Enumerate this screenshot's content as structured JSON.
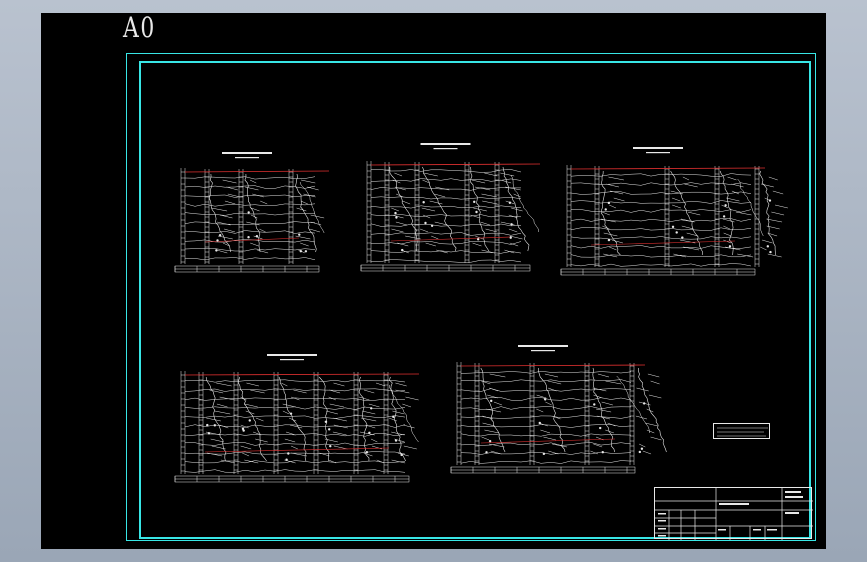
{
  "sheet": {
    "label": "A0",
    "colors": {
      "background": "#000000",
      "frame": "#38e6e6",
      "linework": "#e8e8e8",
      "red_line": "#e03030",
      "desktop": "#a9b3c1"
    }
  },
  "title_block": {
    "cells": [
      "",
      "",
      "",
      "",
      "",
      ""
    ]
  }
}
